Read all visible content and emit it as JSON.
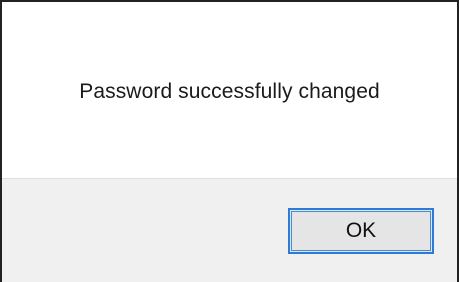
{
  "dialog": {
    "message": "Password successfully changed",
    "ok_label": "OK"
  },
  "colors": {
    "button_focus_border": "#2f7bd1",
    "footer_background": "#f0f0f0",
    "dialog_border": "#222222"
  }
}
